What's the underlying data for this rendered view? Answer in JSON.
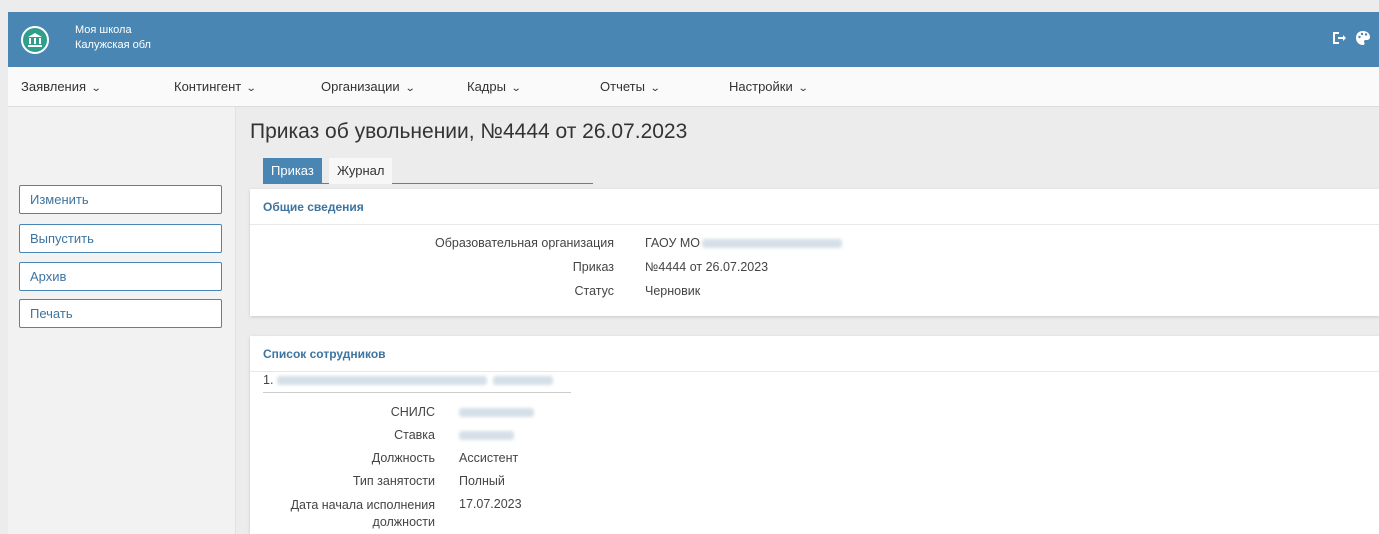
{
  "header": {
    "school_name": "Моя школа",
    "region": "Калужская обл",
    "logo_icon": "school-building-icon",
    "icons": [
      "logout-icon",
      "palette-icon"
    ],
    "brand_color": "#4a86b4"
  },
  "nav": {
    "items": [
      {
        "label": "Заявления"
      },
      {
        "label": "Контингент"
      },
      {
        "label": "Организации"
      },
      {
        "label": "Кадры"
      },
      {
        "label": "Отчеты"
      },
      {
        "label": "Настройки"
      }
    ]
  },
  "sidebar": {
    "buttons": [
      {
        "label": "Изменить"
      },
      {
        "label": "Выпустить"
      },
      {
        "label": "Архив"
      },
      {
        "label": "Печать"
      }
    ]
  },
  "page": {
    "title": "Приказ об увольнении, №4444 от 26.07.2023",
    "tabs": [
      {
        "label": "Приказ",
        "active": true
      },
      {
        "label": "Журнал",
        "active": false
      }
    ]
  },
  "general": {
    "heading": "Общие сведения",
    "rows": [
      {
        "label": "Образовательная организация",
        "value": "ГАОУ МО"
      },
      {
        "label": "Приказ",
        "value": "№4444 от 26.07.2023"
      },
      {
        "label": "Статус",
        "value": "Черновик"
      }
    ]
  },
  "employees": {
    "heading": "Список сотрудников",
    "first_index": "1.",
    "rows": [
      {
        "label": "СНИЛС",
        "value": ""
      },
      {
        "label": "Ставка",
        "value": ""
      },
      {
        "label": "Должность",
        "value": "Ассистент"
      },
      {
        "label": "Тип занятости",
        "value": "Полный"
      },
      {
        "label": "Дата начала исполнения должности",
        "value": "17.07.2023"
      }
    ]
  }
}
